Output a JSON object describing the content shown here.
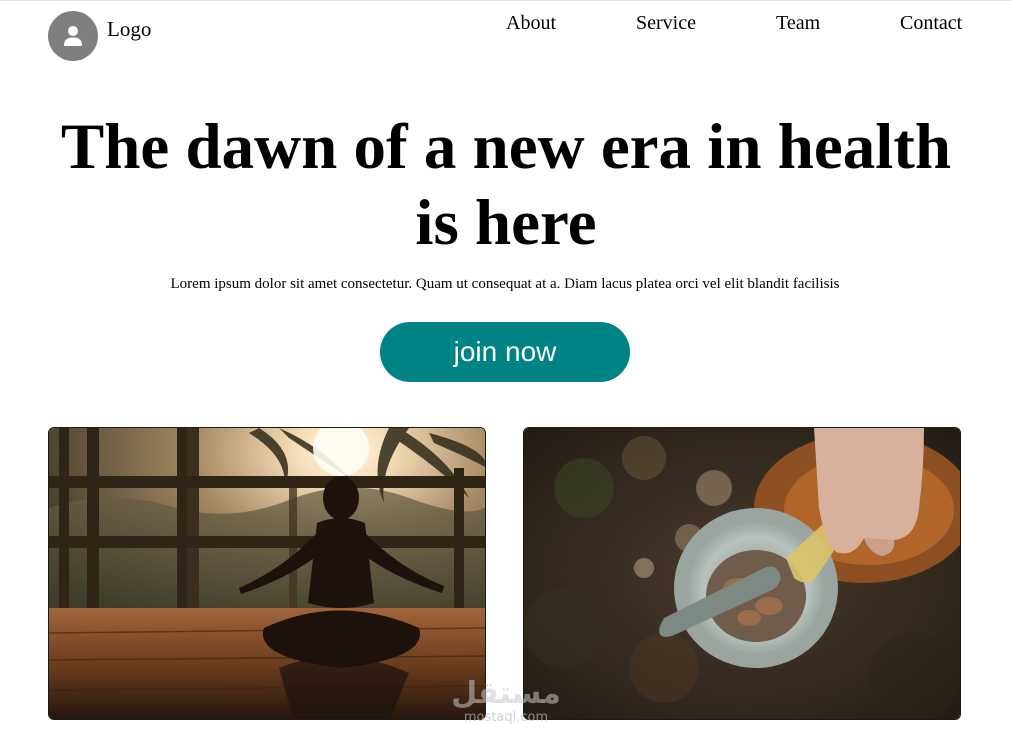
{
  "header": {
    "logo_text": "Logo",
    "avatar_icon": "user-icon",
    "nav": [
      "About",
      "Service",
      "Team",
      "Contact"
    ]
  },
  "hero": {
    "title": "The dawn of a new era in health is here",
    "subtitle": "Lorem ipsum dolor sit amet consectetur. Quam ut consequat at a. Diam lacus platea orci vel elit blandit facilisis",
    "cta_label": "join now",
    "cta_color": "#008385"
  },
  "watermark": {
    "arabic": "مستقل",
    "latin": "mostaql.com"
  }
}
